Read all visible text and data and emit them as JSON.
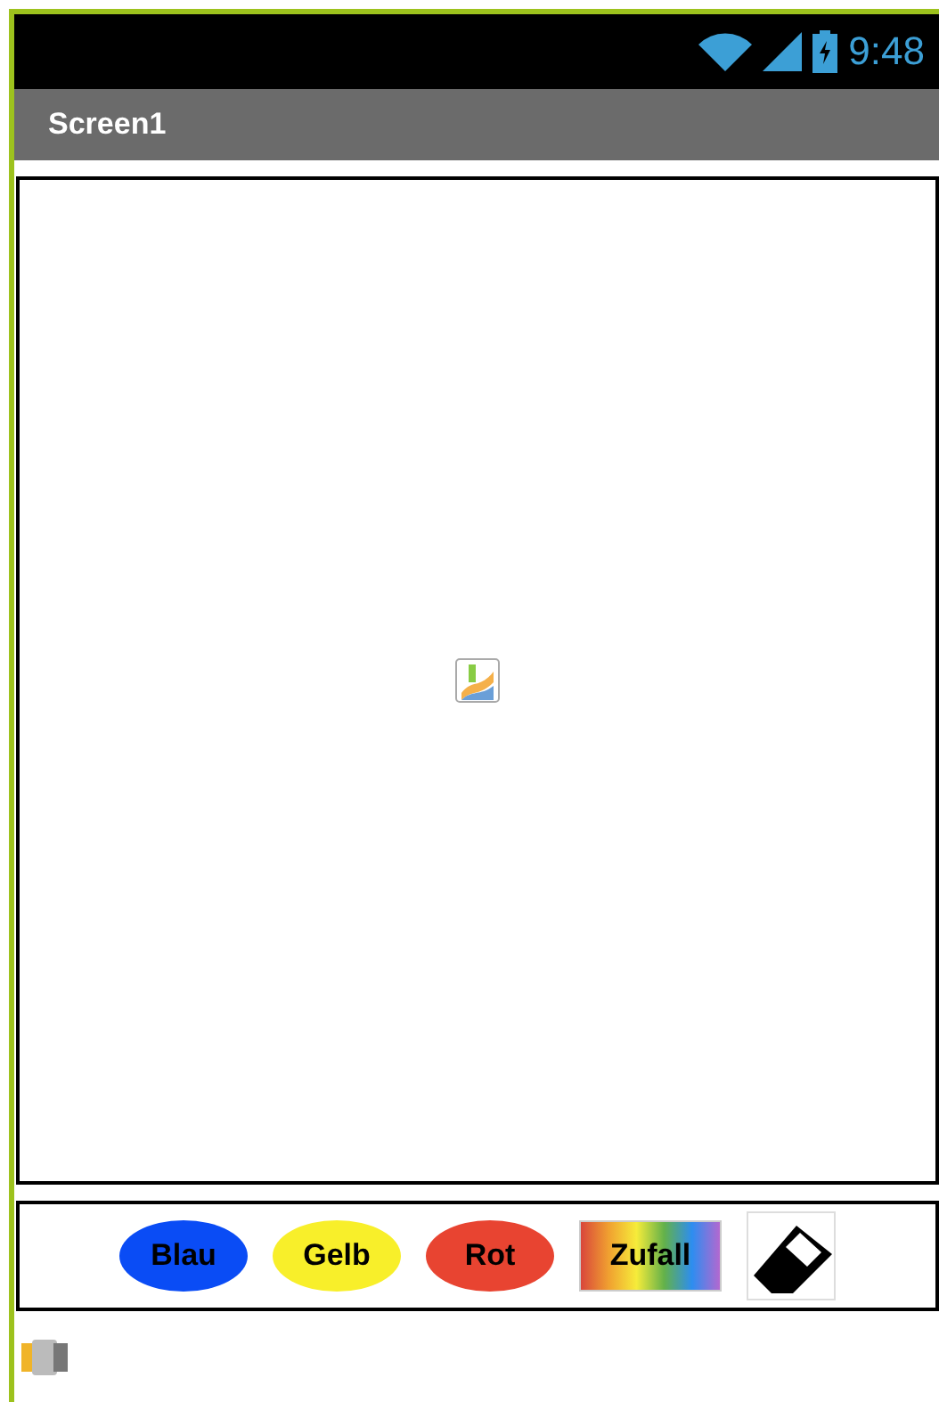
{
  "status_bar": {
    "time": "9:48"
  },
  "title_bar": {
    "title": "Screen1"
  },
  "buttons": [
    {
      "label": "Blau",
      "kind": "oval",
      "color": "#0a4cf5"
    },
    {
      "label": "Gelb",
      "kind": "oval",
      "color": "#f8ef2a"
    },
    {
      "label": "Rot",
      "kind": "oval",
      "color": "#e84431"
    },
    {
      "label": "Zufall",
      "kind": "rainbow"
    },
    {
      "kind": "eraser"
    }
  ]
}
